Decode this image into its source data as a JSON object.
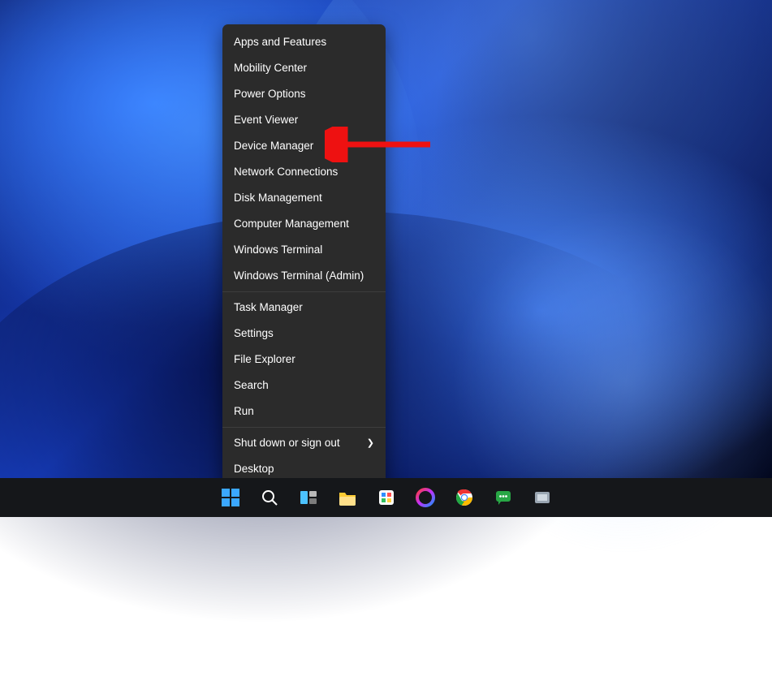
{
  "context_menu": {
    "groups": [
      [
        {
          "id": "apps-features",
          "label": "Apps and Features"
        },
        {
          "id": "mobility-center",
          "label": "Mobility Center"
        },
        {
          "id": "power-options",
          "label": "Power Options"
        },
        {
          "id": "event-viewer",
          "label": "Event Viewer"
        },
        {
          "id": "device-manager",
          "label": "Device Manager"
        },
        {
          "id": "network-connections",
          "label": "Network Connections"
        },
        {
          "id": "disk-management",
          "label": "Disk Management"
        },
        {
          "id": "computer-management",
          "label": "Computer Management"
        },
        {
          "id": "windows-terminal",
          "label": "Windows Terminal"
        },
        {
          "id": "windows-terminal-admin",
          "label": "Windows Terminal (Admin)"
        }
      ],
      [
        {
          "id": "task-manager",
          "label": "Task Manager"
        },
        {
          "id": "settings",
          "label": "Settings"
        },
        {
          "id": "file-explorer",
          "label": "File Explorer"
        },
        {
          "id": "search",
          "label": "Search"
        },
        {
          "id": "run",
          "label": "Run"
        }
      ],
      [
        {
          "id": "shut-down",
          "label": "Shut down or sign out",
          "submenu": true
        },
        {
          "id": "desktop",
          "label": "Desktop"
        }
      ]
    ]
  },
  "annotation": {
    "points_to": "device-manager"
  },
  "taskbar": {
    "items": [
      {
        "id": "start",
        "icon": "windows-start-icon"
      },
      {
        "id": "search",
        "icon": "search-icon"
      },
      {
        "id": "task-view",
        "icon": "task-view-icon"
      },
      {
        "id": "file-explorer",
        "icon": "file-explorer-icon"
      },
      {
        "id": "mail",
        "icon": "mail-icon"
      },
      {
        "id": "opera",
        "icon": "opera-icon"
      },
      {
        "id": "chrome",
        "icon": "chrome-icon"
      },
      {
        "id": "chat",
        "icon": "chat-icon"
      },
      {
        "id": "app",
        "icon": "generic-app-icon"
      }
    ]
  }
}
